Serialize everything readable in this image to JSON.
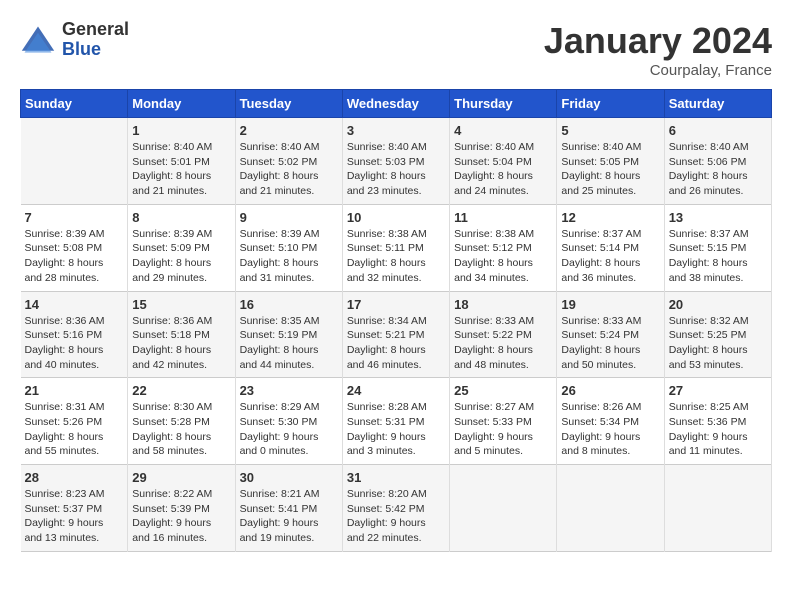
{
  "header": {
    "logo_general": "General",
    "logo_blue": "Blue",
    "month_title": "January 2024",
    "subtitle": "Courpalay, France"
  },
  "days_of_week": [
    "Sunday",
    "Monday",
    "Tuesday",
    "Wednesday",
    "Thursday",
    "Friday",
    "Saturday"
  ],
  "weeks": [
    [
      {
        "day": "",
        "content": ""
      },
      {
        "day": "1",
        "content": "Sunrise: 8:40 AM\nSunset: 5:01 PM\nDaylight: 8 hours\nand 21 minutes."
      },
      {
        "day": "2",
        "content": "Sunrise: 8:40 AM\nSunset: 5:02 PM\nDaylight: 8 hours\nand 21 minutes."
      },
      {
        "day": "3",
        "content": "Sunrise: 8:40 AM\nSunset: 5:03 PM\nDaylight: 8 hours\nand 23 minutes."
      },
      {
        "day": "4",
        "content": "Sunrise: 8:40 AM\nSunset: 5:04 PM\nDaylight: 8 hours\nand 24 minutes."
      },
      {
        "day": "5",
        "content": "Sunrise: 8:40 AM\nSunset: 5:05 PM\nDaylight: 8 hours\nand 25 minutes."
      },
      {
        "day": "6",
        "content": "Sunrise: 8:40 AM\nSunset: 5:06 PM\nDaylight: 8 hours\nand 26 minutes."
      }
    ],
    [
      {
        "day": "7",
        "content": "Sunrise: 8:39 AM\nSunset: 5:08 PM\nDaylight: 8 hours\nand 28 minutes."
      },
      {
        "day": "8",
        "content": "Sunrise: 8:39 AM\nSunset: 5:09 PM\nDaylight: 8 hours\nand 29 minutes."
      },
      {
        "day": "9",
        "content": "Sunrise: 8:39 AM\nSunset: 5:10 PM\nDaylight: 8 hours\nand 31 minutes."
      },
      {
        "day": "10",
        "content": "Sunrise: 8:38 AM\nSunset: 5:11 PM\nDaylight: 8 hours\nand 32 minutes."
      },
      {
        "day": "11",
        "content": "Sunrise: 8:38 AM\nSunset: 5:12 PM\nDaylight: 8 hours\nand 34 minutes."
      },
      {
        "day": "12",
        "content": "Sunrise: 8:37 AM\nSunset: 5:14 PM\nDaylight: 8 hours\nand 36 minutes."
      },
      {
        "day": "13",
        "content": "Sunrise: 8:37 AM\nSunset: 5:15 PM\nDaylight: 8 hours\nand 38 minutes."
      }
    ],
    [
      {
        "day": "14",
        "content": "Sunrise: 8:36 AM\nSunset: 5:16 PM\nDaylight: 8 hours\nand 40 minutes."
      },
      {
        "day": "15",
        "content": "Sunrise: 8:36 AM\nSunset: 5:18 PM\nDaylight: 8 hours\nand 42 minutes."
      },
      {
        "day": "16",
        "content": "Sunrise: 8:35 AM\nSunset: 5:19 PM\nDaylight: 8 hours\nand 44 minutes."
      },
      {
        "day": "17",
        "content": "Sunrise: 8:34 AM\nSunset: 5:21 PM\nDaylight: 8 hours\nand 46 minutes."
      },
      {
        "day": "18",
        "content": "Sunrise: 8:33 AM\nSunset: 5:22 PM\nDaylight: 8 hours\nand 48 minutes."
      },
      {
        "day": "19",
        "content": "Sunrise: 8:33 AM\nSunset: 5:24 PM\nDaylight: 8 hours\nand 50 minutes."
      },
      {
        "day": "20",
        "content": "Sunrise: 8:32 AM\nSunset: 5:25 PM\nDaylight: 8 hours\nand 53 minutes."
      }
    ],
    [
      {
        "day": "21",
        "content": "Sunrise: 8:31 AM\nSunset: 5:26 PM\nDaylight: 8 hours\nand 55 minutes."
      },
      {
        "day": "22",
        "content": "Sunrise: 8:30 AM\nSunset: 5:28 PM\nDaylight: 8 hours\nand 58 minutes."
      },
      {
        "day": "23",
        "content": "Sunrise: 8:29 AM\nSunset: 5:30 PM\nDaylight: 9 hours\nand 0 minutes."
      },
      {
        "day": "24",
        "content": "Sunrise: 8:28 AM\nSunset: 5:31 PM\nDaylight: 9 hours\nand 3 minutes."
      },
      {
        "day": "25",
        "content": "Sunrise: 8:27 AM\nSunset: 5:33 PM\nDaylight: 9 hours\nand 5 minutes."
      },
      {
        "day": "26",
        "content": "Sunrise: 8:26 AM\nSunset: 5:34 PM\nDaylight: 9 hours\nand 8 minutes."
      },
      {
        "day": "27",
        "content": "Sunrise: 8:25 AM\nSunset: 5:36 PM\nDaylight: 9 hours\nand 11 minutes."
      }
    ],
    [
      {
        "day": "28",
        "content": "Sunrise: 8:23 AM\nSunset: 5:37 PM\nDaylight: 9 hours\nand 13 minutes."
      },
      {
        "day": "29",
        "content": "Sunrise: 8:22 AM\nSunset: 5:39 PM\nDaylight: 9 hours\nand 16 minutes."
      },
      {
        "day": "30",
        "content": "Sunrise: 8:21 AM\nSunset: 5:41 PM\nDaylight: 9 hours\nand 19 minutes."
      },
      {
        "day": "31",
        "content": "Sunrise: 8:20 AM\nSunset: 5:42 PM\nDaylight: 9 hours\nand 22 minutes."
      },
      {
        "day": "",
        "content": ""
      },
      {
        "day": "",
        "content": ""
      },
      {
        "day": "",
        "content": ""
      }
    ]
  ]
}
